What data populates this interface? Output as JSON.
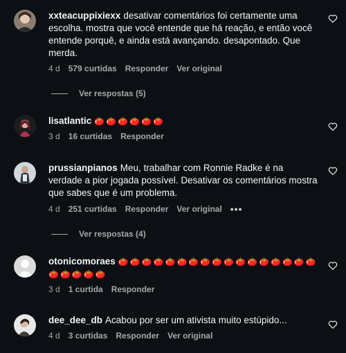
{
  "comments": [
    {
      "user": "xxteacuppixiexx",
      "text": "desativar comentários foi certamente uma escolha. mostra que você entende que há reação, e então você entende porquê, e ainda está avançando. desapontado. Que merda.",
      "time": "4 d",
      "likes": "579 curtidas",
      "reply": "Responder",
      "original": "Ver original",
      "replies": "Ver respostas (5)"
    },
    {
      "user": "lisatlantic",
      "text": "🍅🍅🍅🍅🍅🍅",
      "time": "3 d",
      "likes": "16 curtidas",
      "reply": "Responder"
    },
    {
      "user": "prussianpianos",
      "text": "Meu, trabalhar com Ronnie Radke é na verdade a pior jogada possível. Desativar os comentários mostra que sabes que é um problema.",
      "time": "4 d",
      "likes": "251 curtidas",
      "reply": "Responder",
      "original": "Ver original",
      "more": "•••",
      "replies": "Ver respostas (4)"
    },
    {
      "user": "otonicomoraes",
      "text": "🍅🍅🍅🍅🍅🍅🍅🍅🍅🍅🍅🍅🍅🍅🍅🍅🍅🍅🍅🍅🍅🍅",
      "time": "3 d",
      "likes": "1 curtida",
      "reply": "Responder"
    },
    {
      "user": "dee_dee_db",
      "text": "Acabou por ser um ativista muito estúpido...",
      "time": "4 d",
      "likes": "3 curtidas",
      "reply": "Responder",
      "original": "Ver original"
    }
  ],
  "colors": {
    "background": "#0c0f14",
    "muted": "#a8a8a8"
  }
}
